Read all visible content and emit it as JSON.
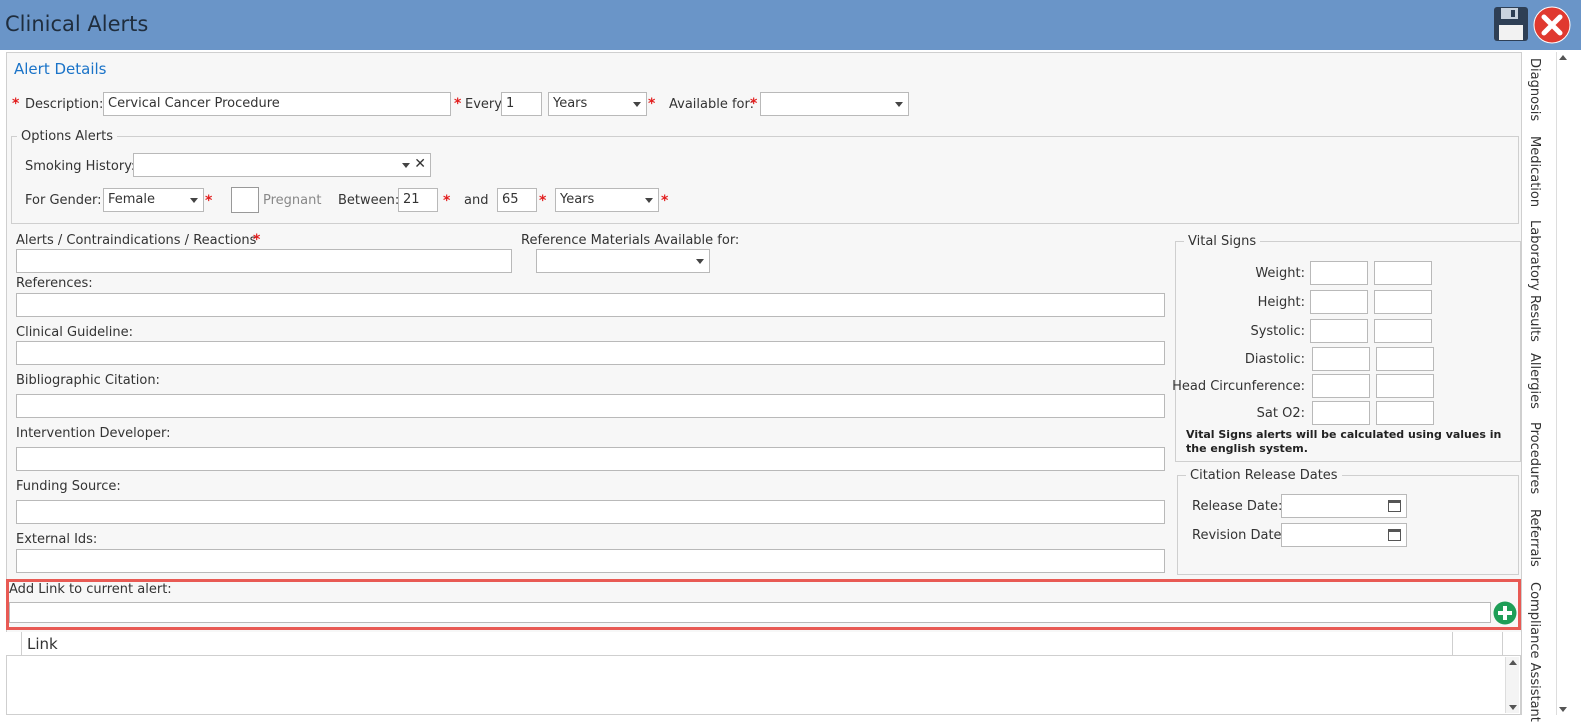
{
  "window": {
    "title": "Clinical Alerts"
  },
  "alert_details": {
    "heading": "Alert Details",
    "description_label": "Description:",
    "description_value": "Cervical Cancer Procedure",
    "every_label": "Every:",
    "every_value": "1",
    "every_unit": "Years",
    "available_for_label": "Available for:",
    "available_for_value": ""
  },
  "options": {
    "title": "Options Alerts",
    "smoking_label": "Smoking History:",
    "gender_label": "For Gender:",
    "gender_value": "Female",
    "pregnant_label": "Pregnant",
    "between_label": "Between:",
    "age_from": "21",
    "and_label": "and",
    "age_to": "65",
    "age_unit": "Years"
  },
  "fields": {
    "alerts_label": "Alerts / Contraindications / Reactions",
    "ref_avail_label": "Reference Materials Available for:",
    "references_label": "References:",
    "guideline_label": "Clinical Guideline:",
    "citation_label": "Bibliographic Citation:",
    "developer_label": "Intervention Developer:",
    "funding_label": "Funding Source:",
    "external_label": "External Ids:"
  },
  "vital_signs": {
    "title": "Vital Signs",
    "rows": [
      "Weight:",
      "Height:",
      "Systolic:",
      "Diastolic:",
      "Head Circunference:",
      "Sat O2:"
    ],
    "note": "Vital Signs alerts will be calculated using values in the english system."
  },
  "citation_dates": {
    "title": "Citation Release Dates",
    "release_label": "Release Date:",
    "revision_label": "Revision Date:"
  },
  "link": {
    "add_label": "Add Link to current alert:",
    "column_header": "Link"
  },
  "side_tabs": [
    "Diagnosis",
    "Medication",
    "Laboratory Results",
    "Allergies",
    "Procedures",
    "Referrals",
    "Compliance Assistant"
  ],
  "icons": {
    "save": "floppy-disk-icon",
    "close": "close-icon",
    "add": "plus-icon"
  },
  "colors": {
    "titlebar": "#6a95c8",
    "required": "#e21d1d",
    "heading": "#1a73c8",
    "highlight": "#e85a54",
    "add_button": "#1e9e57"
  }
}
